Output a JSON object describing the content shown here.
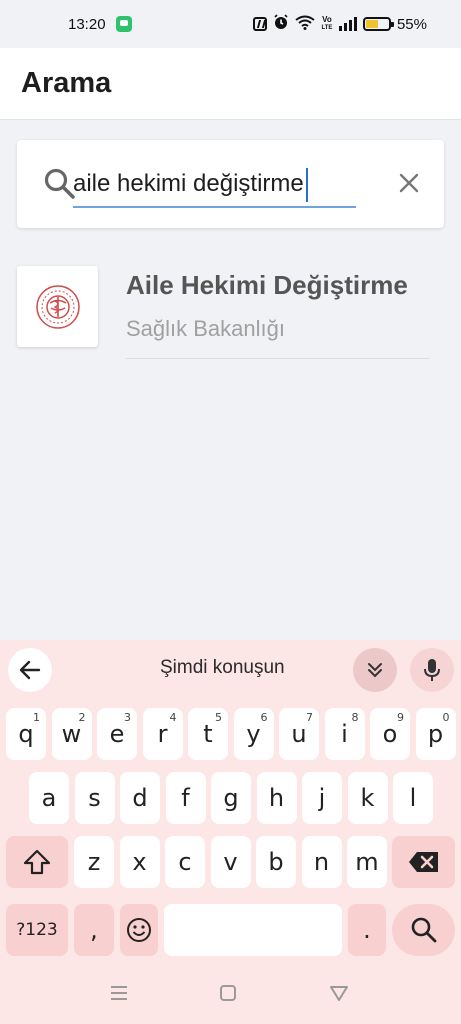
{
  "status": {
    "time": "13:20",
    "battery_percent": 55,
    "battery_text": "55%",
    "volte_label_1": "Vo",
    "volte_label_2": "LTE"
  },
  "header": {
    "title": "Arama"
  },
  "search": {
    "value": "aile hekimi değiştirme",
    "accent_color": "#6ea3dd"
  },
  "results": [
    {
      "title": "Aile Hekimi Değiştirme",
      "subtitle": "Sağlık Bakanlığı"
    }
  ],
  "keyboard": {
    "voice_label": "Şimdi konuşun",
    "row1": [
      {
        "key": "q",
        "hint": "1"
      },
      {
        "key": "w",
        "hint": "2"
      },
      {
        "key": "e",
        "hint": "3"
      },
      {
        "key": "r",
        "hint": "4"
      },
      {
        "key": "t",
        "hint": "5"
      },
      {
        "key": "y",
        "hint": "6"
      },
      {
        "key": "u",
        "hint": "7"
      },
      {
        "key": "i",
        "hint": "8"
      },
      {
        "key": "o",
        "hint": "9"
      },
      {
        "key": "p",
        "hint": "0"
      }
    ],
    "row2": [
      "a",
      "s",
      "d",
      "f",
      "g",
      "h",
      "j",
      "k",
      "l"
    ],
    "row3": [
      "z",
      "x",
      "c",
      "v",
      "b",
      "n",
      "m"
    ],
    "symbols_key": "?123",
    "comma_key": ",",
    "period_key": "."
  },
  "colors": {
    "keyboard_bg": "#fde6e6",
    "special_key": "#f8d0d0",
    "battery_fill": "#f2c12e"
  }
}
